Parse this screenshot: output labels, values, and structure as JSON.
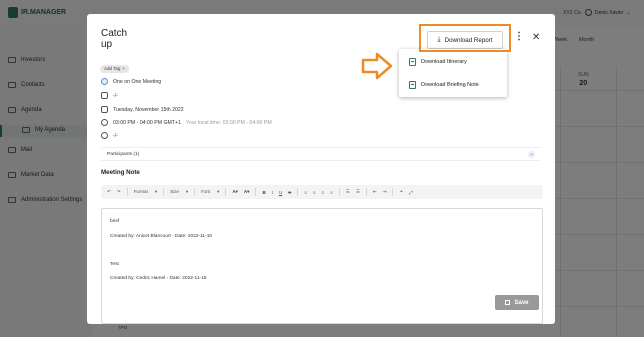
{
  "app": {
    "logo_text": "IR.MANAGER",
    "company": "XYZ Co.",
    "user_name": "Denis Xavier"
  },
  "sidebar": {
    "items": [
      {
        "label": "Investors"
      },
      {
        "label": "Contacts"
      },
      {
        "label": "Agenda"
      },
      {
        "label": "My Agenda"
      },
      {
        "label": "Mail"
      },
      {
        "label": "Market Data"
      },
      {
        "label": "Administration Settings"
      }
    ]
  },
  "calendar": {
    "view_week": "Week",
    "view_month": "Month",
    "day_name": "SUN",
    "day_number": "20",
    "time_label": "7PM"
  },
  "modal": {
    "title": "Catch up",
    "download_report_label": "Download Report",
    "add_tag_label": "Add Tag",
    "meeting_type": "One on One Meeting",
    "company_value": "-/-",
    "date": "Tuesday, November 15th 2022",
    "time": "03:00 PM - 04:00 PM GMT+1",
    "local_time": "Your local time: 03:00 PM - 04:00 PM",
    "location_value": "-/-",
    "participants_label": "Participants (1)",
    "meeting_note_label": "Meeting Note",
    "toolbar": {
      "format": "Format",
      "size": "Size",
      "font": "Font"
    },
    "notes": [
      {
        "text": "brief"
      },
      {
        "text": "Created by: Anicet Blancourt - Date: 2022-11-10"
      },
      {
        "text": "Test"
      },
      {
        "text": "Created by: Cedric Hamel - Date: 2022-11-16"
      }
    ],
    "save_label": "Save"
  },
  "dropdown": {
    "items": [
      {
        "label": "Download Itinerary"
      },
      {
        "label": "Download Briefing Note"
      }
    ]
  },
  "colors": {
    "brand": "#2e7d5b",
    "annotation": "#f08a24",
    "save_disabled": "#999999"
  }
}
